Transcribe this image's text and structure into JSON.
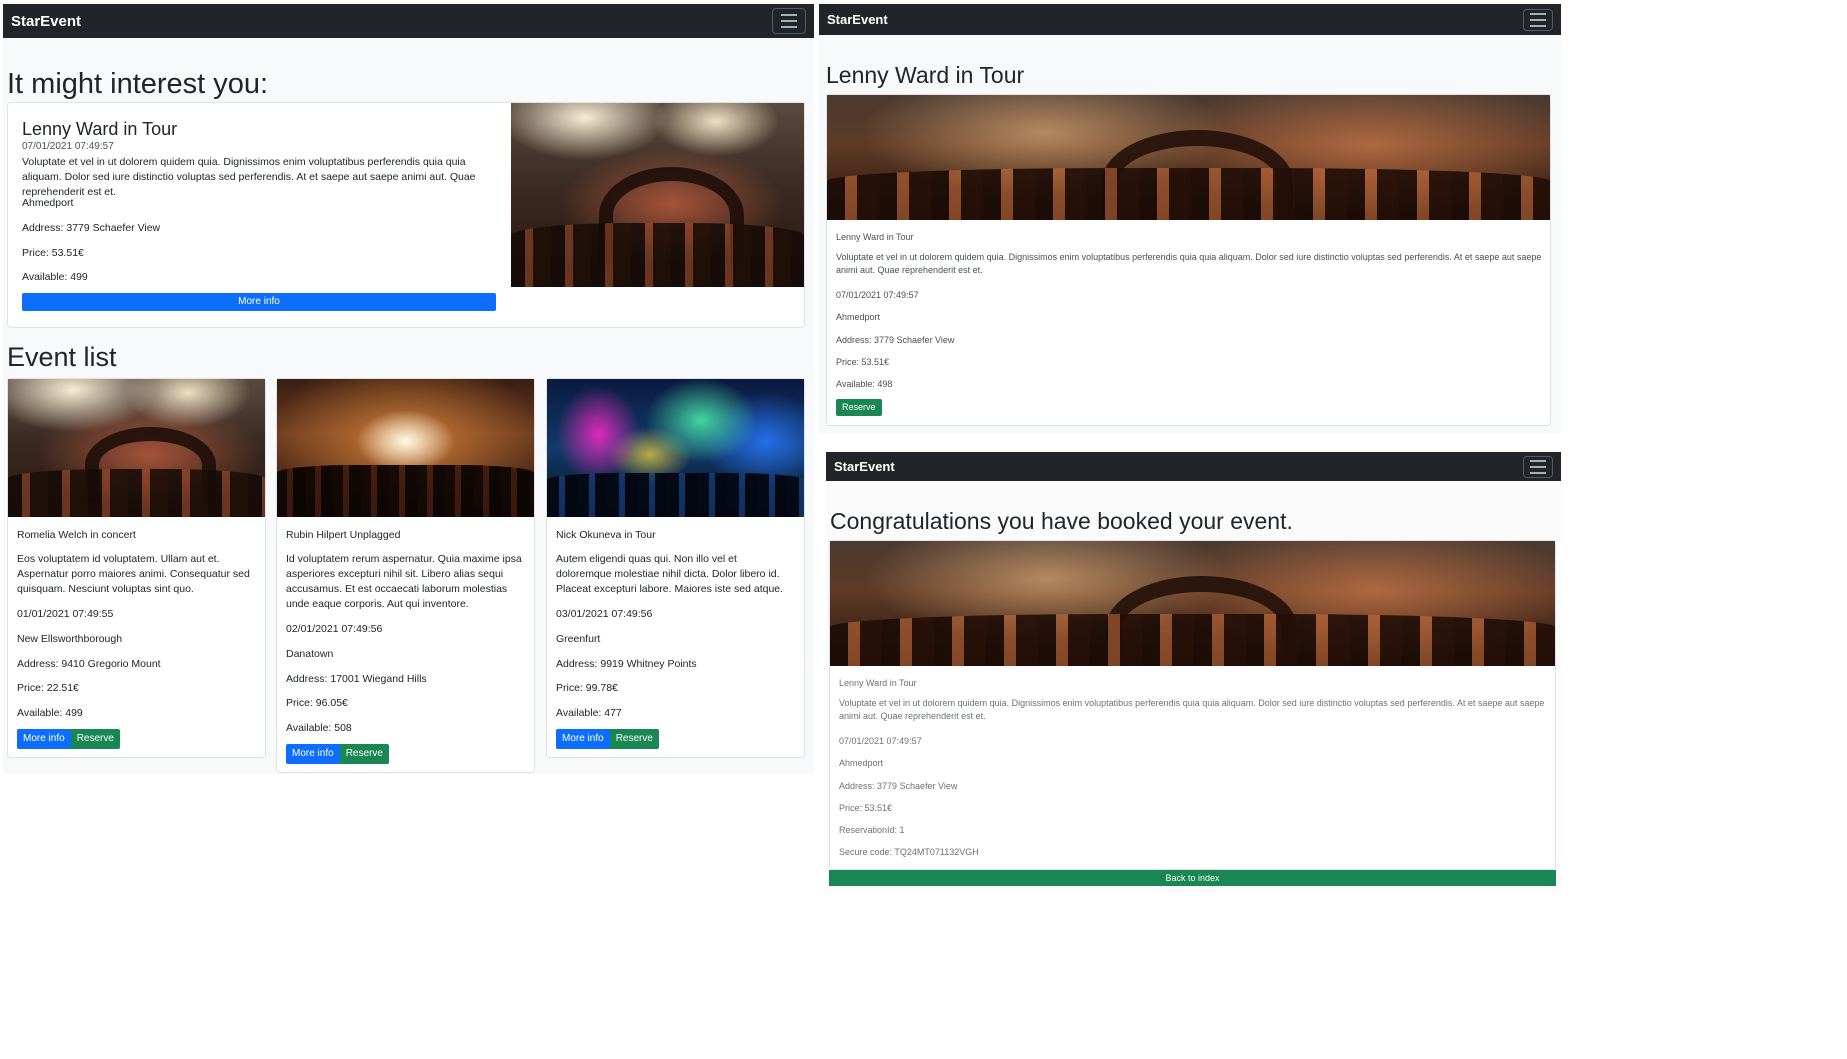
{
  "index": {
    "brand": "StarEvent",
    "interest_heading": "It might interest you:",
    "featured": {
      "title": "Lenny Ward in Tour",
      "date": "07/01/2021 07:49:57",
      "description": "Voluptate et vel in ut dolorem quidem quia. Dignissimos enim voluptatibus perferendis quia quia aliquam. Dolor sed iure distinctio voluptas sed perferendis. At et saepe aut saepe animi aut. Quae reprehenderit est et.",
      "city": "Ahmedport",
      "address": "Address: 3779 Schaefer View",
      "price": "Price: 53.51€",
      "available": "Available: 499",
      "more_info_label": "More info"
    },
    "event_list_heading": "Event list",
    "events": [
      {
        "title": "Romelia Welch in concert",
        "description": "Eos voluptatem id voluptatem. Ullam aut et. Aspernatur porro maiores animi. Consequatur sed quisquam. Nesciunt voluptas sint quo.",
        "date": "01/01/2021 07:49:55",
        "city": "New Ellsworthborough",
        "address": "Address: 9410 Gregorio Mount",
        "price": "Price: 22.51€",
        "available": "Available: 499",
        "more_info_label": "More info",
        "reserve_label": "Reserve"
      },
      {
        "title": "Rubin Hilpert Unplagged",
        "description": "Id voluptatem rerum aspernatur. Quia maxime ipsa asperiores excepturi nihil sit. Libero alias sequi accusamus. Et est occaecati laborum molestias unde eaque corporis. Aut qui inventore.",
        "date": "02/01/2021 07:49:56",
        "city": "Danatown",
        "address": "Address: 17001 Wiegand Hills",
        "price": "Price: 96.05€",
        "available": "Available: 508",
        "more_info_label": "More info",
        "reserve_label": "Reserve"
      },
      {
        "title": "Nick Okuneva in Tour",
        "description": "Autem eligendi quas qui. Non illo vel et doloremque molestiae nihil dicta. Dolor libero id. Placeat excepturi labore. Maiores iste sed atque.",
        "date": "03/01/2021 07:49:56",
        "city": "Greenfurt",
        "address": "Address: 9919 Whitney Points",
        "price": "Price: 99.78€",
        "available": "Available: 477",
        "more_info_label": "More info",
        "reserve_label": "Reserve"
      }
    ]
  },
  "detail": {
    "brand": "StarEvent",
    "heading": "Lenny Ward in Tour",
    "title": "Lenny Ward in Tour",
    "description": "Voluptate et vel in ut dolorem quidem quia. Dignissimos enim voluptatibus perferendis quia quia aliquam. Dolor sed iure distinctio voluptas sed perferendis. At et saepe aut saepe animi aut. Quae reprehenderit est et.",
    "date": "07/01/2021 07:49:57",
    "city": "Ahmedport",
    "address": "Address: 3779 Schaefer View",
    "price": "Price: 53.51€",
    "available": "Available: 498",
    "reserve_label": "Reserve"
  },
  "confirmation": {
    "brand": "StarEvent",
    "heading": "Congratulations you have booked your event.",
    "title": "Lenny Ward in Tour",
    "description": "Voluptate et vel in ut dolorem quidem quia. Dignissimos enim voluptatibus perferendis quia quia aliquam. Dolor sed iure distinctio voluptas sed perferendis. At et saepe aut saepe animi aut. Quae reprehenderit est et.",
    "date": "07/01/2021 07:49:57",
    "city": "Ahmedport",
    "address": "Address: 3779 Schaefer View",
    "price": "Price: 53.51€",
    "reservation_id": "ReservationId: 1",
    "secure_code": "Secure code: TQ24MT071132VGH",
    "back_label": "Back to index"
  },
  "colors": {
    "navbar": "#212529",
    "primary": "#0d6efd",
    "success": "#198754",
    "page_bg": "#f8f9fa"
  }
}
